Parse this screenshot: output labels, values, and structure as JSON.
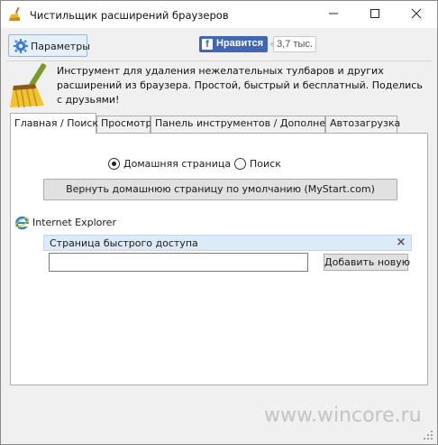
{
  "window": {
    "title": "Чистильщик расширений браузеров",
    "app_icon": "broom-icon"
  },
  "toolbar": {
    "params_label": "Параметры",
    "params_icon": "gear-icon",
    "fb_like_label": "Нравится",
    "fb_like_count": "3,7 тыс.",
    "fb_color": "#4267b2"
  },
  "header": {
    "description": "Инструмент для удаления нежелательных тулбаров и других расширений из браузера. Простой, быстрый и бесплатный. Поделись с друзьями!"
  },
  "tabs": [
    {
      "label": "Главная / Поиск",
      "active": true
    },
    {
      "label": "Просмотр",
      "active": false
    },
    {
      "label": "Панель инструментов / Дополнения",
      "active": false
    },
    {
      "label": "Автозагрузка",
      "active": false
    }
  ],
  "main": {
    "radio_home_label": "Домашняя страница",
    "radio_search_label": "Поиск",
    "selected_radio": "Домашняя страница",
    "restore_button_label": "Вернуть домашнюю страницу по умолчанию (MyStart.com)",
    "browser_label": "Internet Explorer",
    "browser_icon": "internet-explorer-icon",
    "quick_access_label": "Страница быстрого доступа",
    "url_input_value": "",
    "add_button_label": "Добавить новую"
  },
  "watermark": "www.wincore.ru"
}
